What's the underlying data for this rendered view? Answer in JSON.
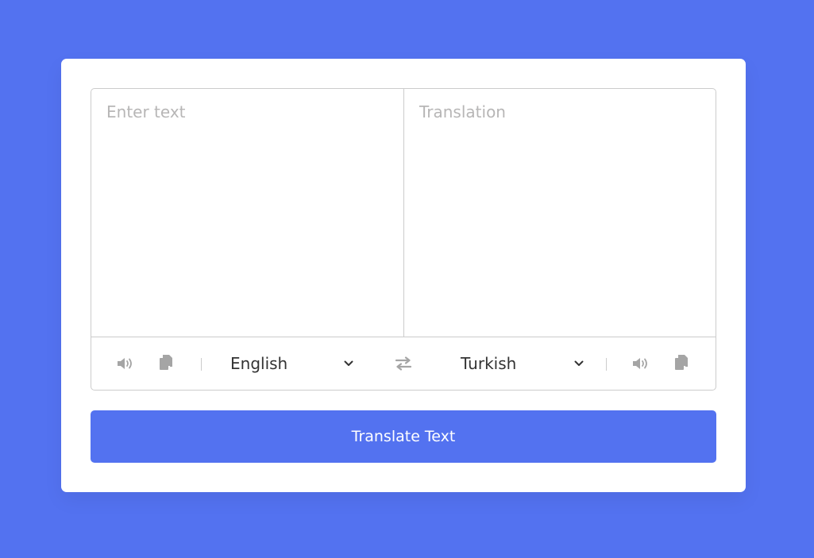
{
  "input": {
    "placeholder": "Enter text",
    "value": ""
  },
  "output": {
    "placeholder": "Translation",
    "value": ""
  },
  "controls": {
    "from_language": "English",
    "to_language": "Turkish",
    "icons": {
      "speak": "volume-icon",
      "copy": "copy-icon",
      "swap": "exchange-icon",
      "dropdown": "chevron-down-icon"
    }
  },
  "button": {
    "label": "Translate Text"
  },
  "colors": {
    "background": "#5372f0",
    "card": "#ffffff",
    "border": "#cccccc",
    "icon": "#a5a5a5",
    "placeholder": "#b7b6b6",
    "button": "#5372f0"
  }
}
